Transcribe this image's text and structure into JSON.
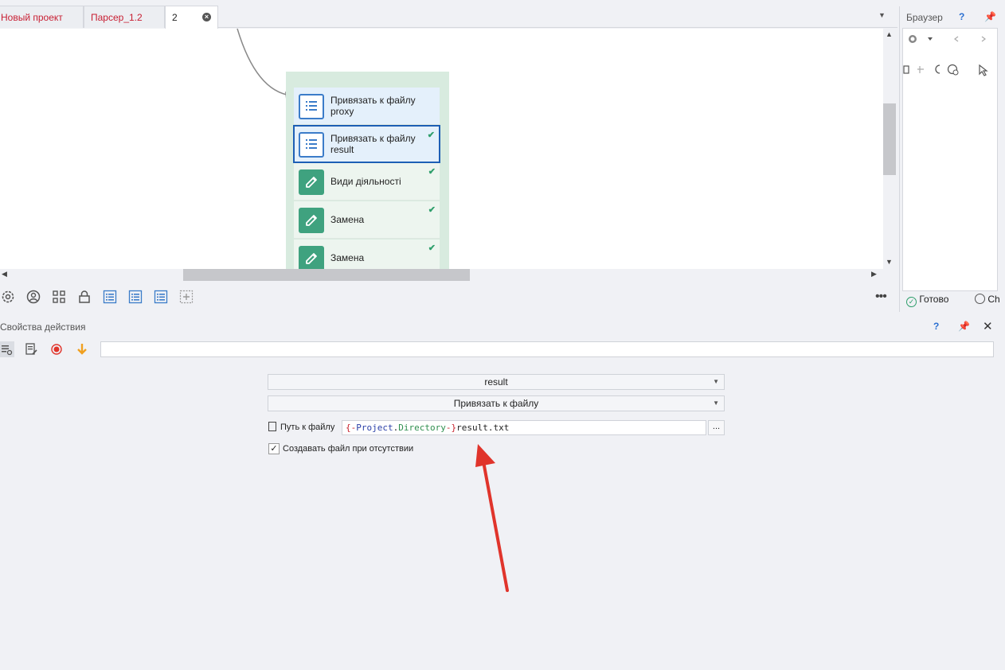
{
  "tabs": [
    {
      "label": "Новый проект",
      "active": false
    },
    {
      "label": "Парсер_1.2",
      "active": false
    },
    {
      "label": "2",
      "active": true
    }
  ],
  "nodes": [
    {
      "label": "Привязать к файлу proxy",
      "kind": "list",
      "checked": false,
      "selected": false
    },
    {
      "label": "Привязать к файлу result",
      "kind": "list",
      "checked": true,
      "selected": true
    },
    {
      "label": "Види діяльності",
      "kind": "edit",
      "checked": true,
      "selected": false
    },
    {
      "label": "Замена",
      "kind": "edit",
      "checked": true,
      "selected": false
    },
    {
      "label": "Замена",
      "kind": "edit",
      "checked": true,
      "selected": false
    }
  ],
  "browser": {
    "title": "Браузер",
    "help": "?",
    "status_ready": "Готово",
    "status_second": "Ch"
  },
  "properties": {
    "title": "Свойства действия",
    "help": "?",
    "list_name": "result",
    "action": "Привязать к файлу",
    "path_label": "Путь к файлу",
    "path_value": {
      "open": "{-",
      "project": "Project",
      "dot": ".",
      "dir": "Directory",
      "close": "-}",
      "rest": "result.txt"
    },
    "browse": "...",
    "create_label": "Создавать файл при отсутствии",
    "create_checked": true
  },
  "colors": {
    "accent_red": "#c81e32",
    "selection_blue": "#1d5fb5",
    "action_green": "#3fa27f",
    "annotation_red": "#e0342b"
  }
}
